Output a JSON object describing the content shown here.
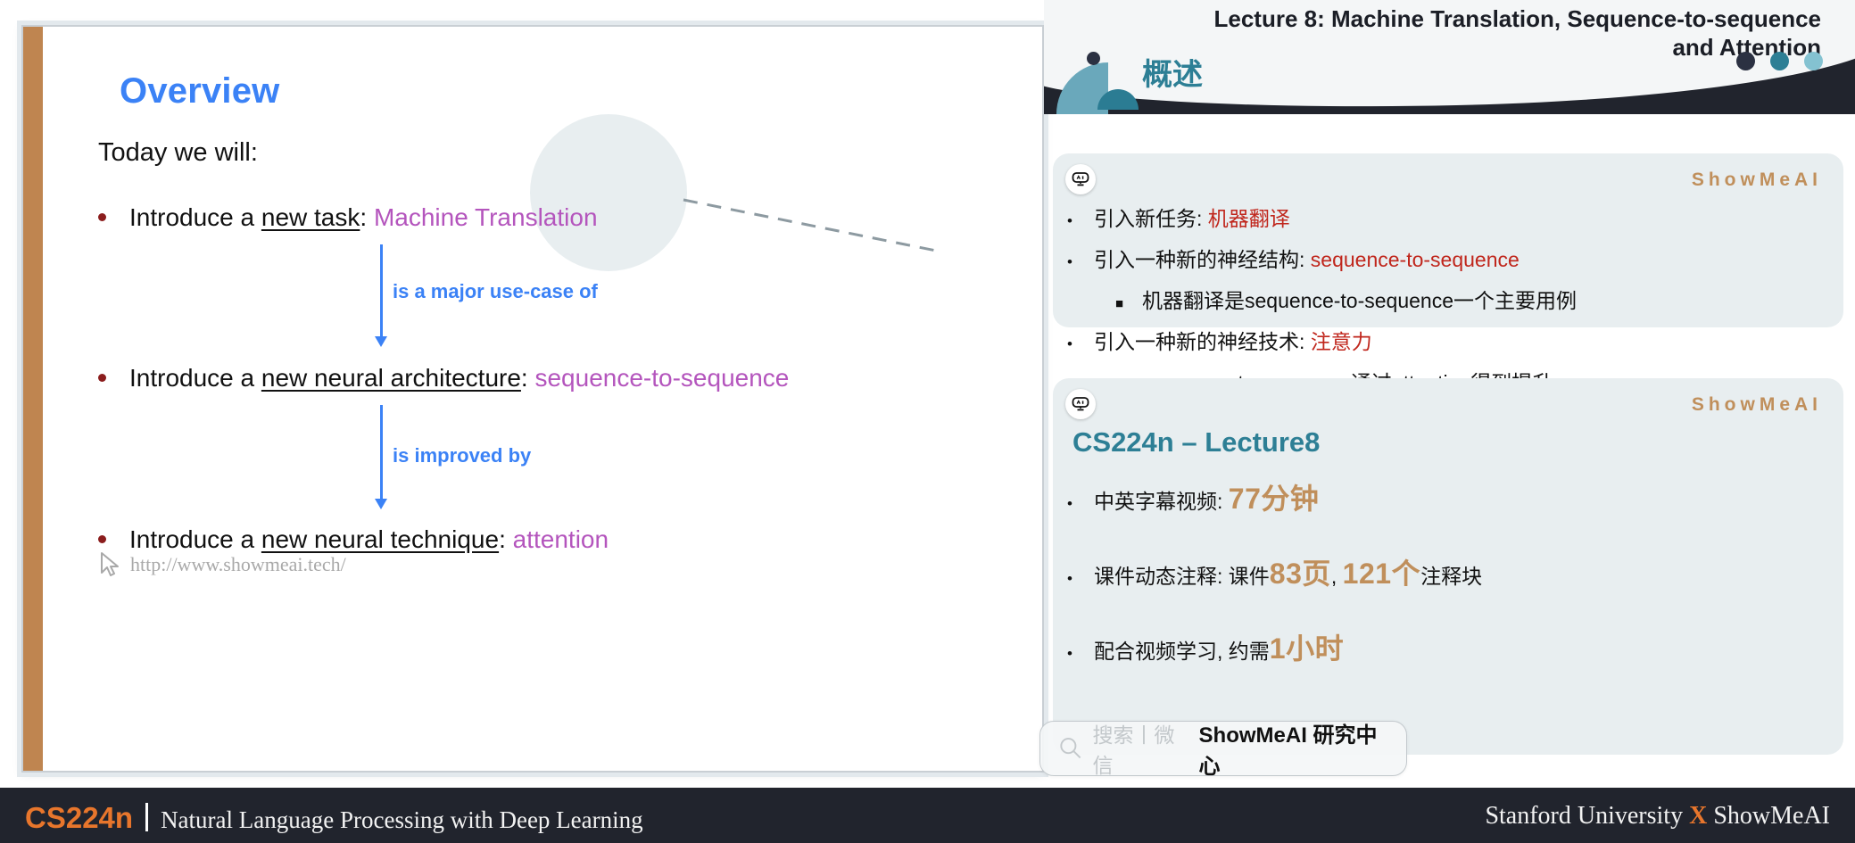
{
  "slide": {
    "title": "Overview",
    "lead": "Today we will:",
    "bullets": [
      {
        "prefix": "Introduce a ",
        "underlined": "new task",
        "colon": ": ",
        "highlight": "Machine Translation"
      },
      {
        "prefix": "Introduce a ",
        "underlined": "new neural architecture",
        "colon": ": ",
        "highlight": "sequence-to-sequence"
      },
      {
        "prefix": "Introduce a ",
        "underlined": "new neural technique",
        "colon": ": ",
        "highlight": "attention"
      }
    ],
    "arrow_labels": [
      "is a major use-case of",
      "is improved by"
    ],
    "watermark": {
      "icon": "cursor-icon",
      "text": "http://www.showmeai.tech/"
    },
    "accent_color": "#bf8550",
    "title_color": "#3b82f6",
    "highlight_color": "#b455bd"
  },
  "notes": {
    "header": {
      "title_line1": "Lecture 8:  Machine Translation, Sequence-to-sequence",
      "title_line2": "and Attention",
      "section_title": "概述",
      "dots": [
        "#2b3142",
        "#2d7f95",
        "#84c2d1"
      ]
    },
    "card1": {
      "badge_icon": "ai-robot-icon",
      "brand": "ShowMeAI",
      "items": [
        {
          "level": 1,
          "marker": "•",
          "text": "引入新任务: ",
          "accent": "机器翻译"
        },
        {
          "level": 1,
          "marker": "•",
          "text": "引入一种新的神经结构: ",
          "accent": "sequence-to-sequence"
        },
        {
          "level": 2,
          "marker": "■",
          "text": "机器翻译是sequence-to-sequence一个主要用例",
          "accent": ""
        },
        {
          "level": 1,
          "marker": "•",
          "text": "引入一种新的神经技术: ",
          "accent": "注意力"
        },
        {
          "level": 2,
          "marker": "■",
          "text": "sequence-to-sequence通过attention得到提升",
          "accent": ""
        }
      ],
      "accent_color": "#c0261c"
    },
    "card2": {
      "badge_icon": "ai-robot-icon",
      "brand": "ShowMeAI",
      "title": "CS224n – Lecture8",
      "items": [
        {
          "marker": "•",
          "pre": "中英字幕视频: ",
          "big": "77分钟",
          "mid": "",
          "big2": "",
          "post": ""
        },
        {
          "marker": "•",
          "pre": "课件动态注释: 课件",
          "big": "83页",
          "mid": ", ",
          "big2": "121个",
          "post": "注释块"
        },
        {
          "marker": "•",
          "pre": "配合视频学习, 约需",
          "big": "1小时",
          "mid": "",
          "big2": "",
          "post": ""
        }
      ],
      "big_color": "#c08f5b",
      "title_color": "#2d7f95"
    },
    "tooltip": {
      "search_icon": "search-icon",
      "ghost_text": "搜索丨微信",
      "strong_text": "ShowMeAI 研究中心"
    }
  },
  "footer": {
    "course": "CS224n",
    "subtitle": "Natural Language Processing with Deep Learning",
    "right_pre": "Stanford University ",
    "right_x": "X",
    "right_post": " ShowMeAI",
    "accent_color": "#e8762c"
  }
}
